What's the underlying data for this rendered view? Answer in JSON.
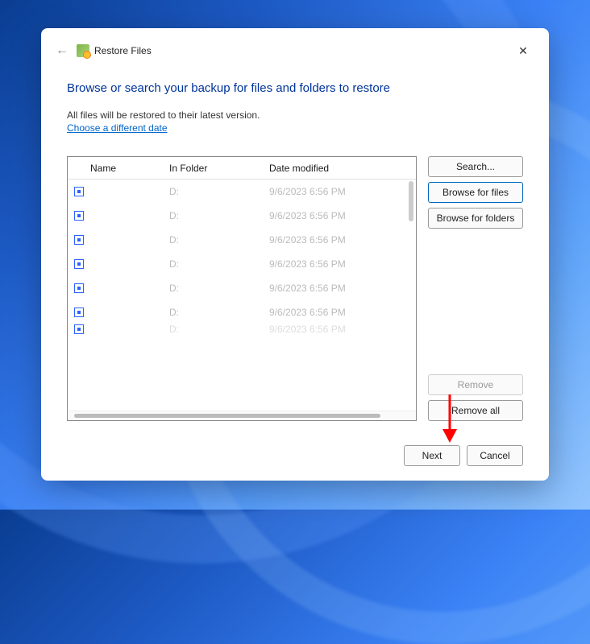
{
  "titlebar": {
    "title": "Restore Files"
  },
  "heading": "Browse or search your backup for files and folders to restore",
  "subtext": "All files will be restored to their latest version.",
  "link": "Choose a different date",
  "columns": {
    "name": "Name",
    "folder": "In Folder",
    "date": "Date modified"
  },
  "rows": [
    {
      "name": "",
      "folder": "D:",
      "date": "9/6/2023 6:56 PM"
    },
    {
      "name": "",
      "folder": "D:",
      "date": "9/6/2023 6:56 PM"
    },
    {
      "name": "",
      "folder": "D:",
      "date": "9/6/2023 6:56 PM"
    },
    {
      "name": "",
      "folder": "D:",
      "date": "9/6/2023 6:56 PM"
    },
    {
      "name": "",
      "folder": "D:",
      "date": "9/6/2023 6:56 PM"
    },
    {
      "name": "",
      "folder": "D:",
      "date": "9/6/2023 6:56 PM"
    }
  ],
  "buttons": {
    "search": "Search...",
    "browse_files": "Browse for files",
    "browse_folders": "Browse for folders",
    "remove": "Remove",
    "remove_all": "Remove all",
    "next": "Next",
    "cancel": "Cancel"
  }
}
